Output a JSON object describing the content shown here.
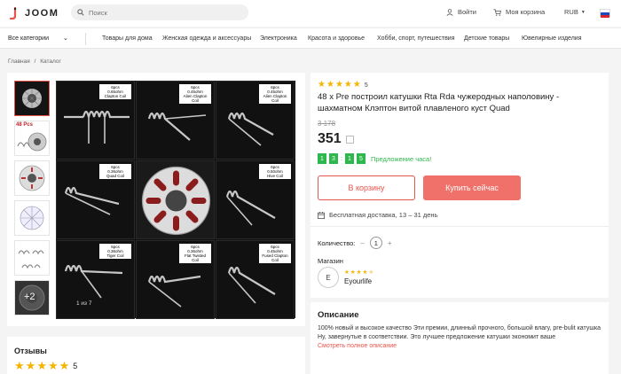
{
  "header": {
    "logo_text": "JOOM",
    "search_placeholder": "Поиск",
    "login_label": "Войти",
    "cart_label": "Моя корзина",
    "currency_label": "RUB"
  },
  "catbar": {
    "all_label": "Все категории",
    "categories": [
      "Товары для дома",
      "Женская одежда и аксессуары",
      "Электроника",
      "Красота и здоровье",
      "Хобби, спорт, путешествия",
      "Детские товары",
      "Ювелирные изделия"
    ]
  },
  "breadcrumbs": [
    "Главная",
    "/",
    "Каталог"
  ],
  "gallery": {
    "thumb_badge": "48 Pcs",
    "more_label": "+2",
    "counter": "1 из 7",
    "cells": [
      {
        "line1": "6pcs",
        "line2": "0.65ohm",
        "line3": "Clapton Coil"
      },
      {
        "line1": "6pcs",
        "line2": "0.45ohm",
        "line3": "Alien Clapton Coil"
      },
      {
        "line1": "6pcs",
        "line2": "0.45ohm",
        "line3": "Alien Clapton Coil"
      },
      {
        "line1": "6pcs",
        "line2": "0.36ohm",
        "line3": "Quad Coil"
      },
      {
        "line1": "",
        "line2": "",
        "line3": ""
      },
      {
        "line1": "6pcs",
        "line2": "0.50ohm",
        "line3": "Hive Coil"
      },
      {
        "line1": "6pcs",
        "line2": "0.36ohm",
        "line3": "Tiger Coil"
      },
      {
        "line1": "6pcs",
        "line2": "0.36ohm",
        "line3": "Flat Twisted Coil"
      },
      {
        "line1": "6pcs",
        "line2": "0.45ohm",
        "line3": "Fused Clapton Coil"
      }
    ]
  },
  "reviews": {
    "title": "Отзывы",
    "rating": "5",
    "rating_value": 5
  },
  "product": {
    "rating": "5",
    "rating_value": 5,
    "title": "48 x Pre построил катушки Rta Rda чужеродных наполовину - шахматном Клэптон витой плавленого куст Quad",
    "old_price": "3 178",
    "price": "351",
    "timer": [
      "1",
      "3",
      "1",
      "5"
    ],
    "offer_label": "Предложение часа!",
    "cart_button": "В корзину",
    "buy_button": "Купить сейчас",
    "delivery": "Бесплатная доставка, 13 – 31 день",
    "quantity_label": "Количество:",
    "quantity_minus": "–",
    "quantity_value": "1",
    "quantity_plus": "+",
    "store_label": "Магазин",
    "store_initial": "E",
    "store_name": "Eyourlife",
    "store_rating_value": 4.5
  },
  "description": {
    "title": "Описание",
    "text": "100% новый и высокое качество  Эти премии, длинный прочного, большой влагу, pre-bulit катушка  Ну, завернутые в соответствии. Это лучшее предложение катушки экономит ваше",
    "more_link": "Смотреть полное описание"
  },
  "colors": {
    "accent": "#e8534b",
    "buy_bg": "#f0706a",
    "offer_green": "#2db84d",
    "star": "#f4b400"
  }
}
